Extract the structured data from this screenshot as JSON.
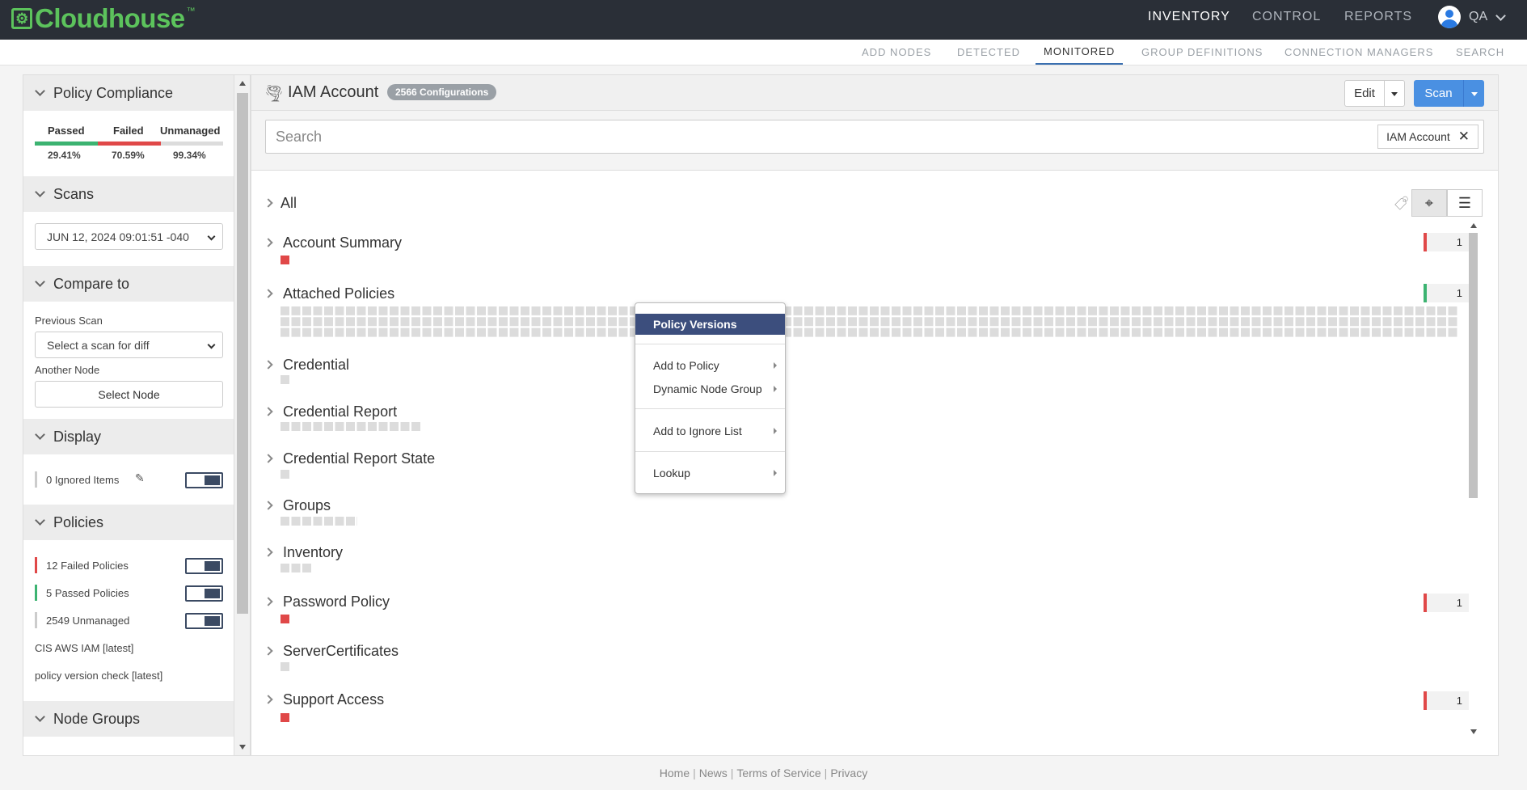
{
  "header": {
    "logo_text": "Cloudhouse",
    "logo_mark": "™",
    "nav": [
      {
        "label": "INVENTORY",
        "active": true
      },
      {
        "label": "CONTROL",
        "active": false
      },
      {
        "label": "REPORTS",
        "active": false
      }
    ],
    "user": "QA"
  },
  "subnav": [
    {
      "label": "ADD NODES"
    },
    {
      "label": "DETECTED"
    },
    {
      "label": "MONITORED",
      "active": true
    },
    {
      "label": "GROUP DEFINITIONS"
    },
    {
      "label": "CONNECTION MANAGERS"
    },
    {
      "label": "SEARCH"
    }
  ],
  "sidebar": {
    "policy_compliance": {
      "title": "Policy Compliance",
      "passed_label": "Passed",
      "passed_pct": "29.41%",
      "failed_label": "Failed",
      "failed_pct": "70.59%",
      "unmanaged_label": "Unmanaged",
      "unmanaged_pct": "99.34%"
    },
    "scans": {
      "title": "Scans",
      "selected": "JUN 12, 2024 09:01:51 -040"
    },
    "compare": {
      "title": "Compare to",
      "previous_label": "Previous Scan",
      "previous_select": "Select a scan for diff",
      "another_label": "Another Node",
      "select_node": "Select Node"
    },
    "display": {
      "title": "Display",
      "ignored": "0 Ignored Items"
    },
    "policies": {
      "title": "Policies",
      "failed": "12 Failed Policies",
      "passed": "5 Passed Policies",
      "unmanaged": "2549 Unmanaged",
      "list": [
        "CIS AWS IAM [latest]",
        "policy version check [latest]"
      ]
    },
    "node_groups": {
      "title": "Node Groups"
    }
  },
  "main": {
    "title": "IAM Account",
    "badge": "2566 Configurations",
    "edit": "Edit",
    "scan": "Scan",
    "search_placeholder": "Search",
    "chip": "IAM Account",
    "chip_close": "✕",
    "all_label": "All",
    "rows": [
      {
        "label": "Account Summary",
        "count": "1",
        "status": "failed"
      },
      {
        "label": "Attached Policies",
        "count": "1",
        "status": "passed"
      },
      {
        "label": "Credential"
      },
      {
        "label": "Credential Report"
      },
      {
        "label": "Credential Report State"
      },
      {
        "label": "Groups"
      },
      {
        "label": "Inventory"
      },
      {
        "label": "Password Policy",
        "count": "1",
        "status": "failed"
      },
      {
        "label": "ServerCertificates"
      },
      {
        "label": "Support Access",
        "count": "1",
        "status": "failed"
      }
    ]
  },
  "context_menu": {
    "items": [
      "Policy Versions",
      "Add to Policy",
      "Dynamic Node Group",
      "Add to Ignore List",
      "Lookup"
    ]
  },
  "footer": {
    "links": [
      "Home",
      "News",
      "Terms of Service",
      "Privacy"
    ]
  },
  "colors": {
    "brand": "#5cc35c",
    "accent": "#4a90e2",
    "failed": "#e04848",
    "passed": "#3cb371",
    "menu_highlight": "#3c4e7d"
  }
}
